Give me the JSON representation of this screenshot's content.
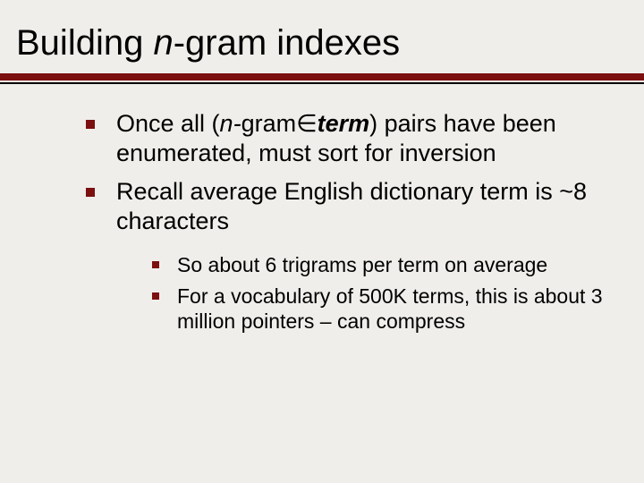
{
  "title": {
    "pre": "Building ",
    "n": "n",
    "post": "-gram indexes"
  },
  "bullets": [
    {
      "t1": "Once all (",
      "t2": "n-",
      "t3": "gram",
      "t4": "∈",
      "t5": "term",
      "t6": ") pairs have been enumerated, must sort for inversion"
    },
    {
      "text": "Recall average English dictionary term is ~8 characters"
    }
  ],
  "subbullets": [
    {
      "text": "So about 6 trigrams per term on average"
    },
    {
      "text": "For a vocabulary of 500K terms, this is about 3 million pointers – can compress"
    }
  ]
}
